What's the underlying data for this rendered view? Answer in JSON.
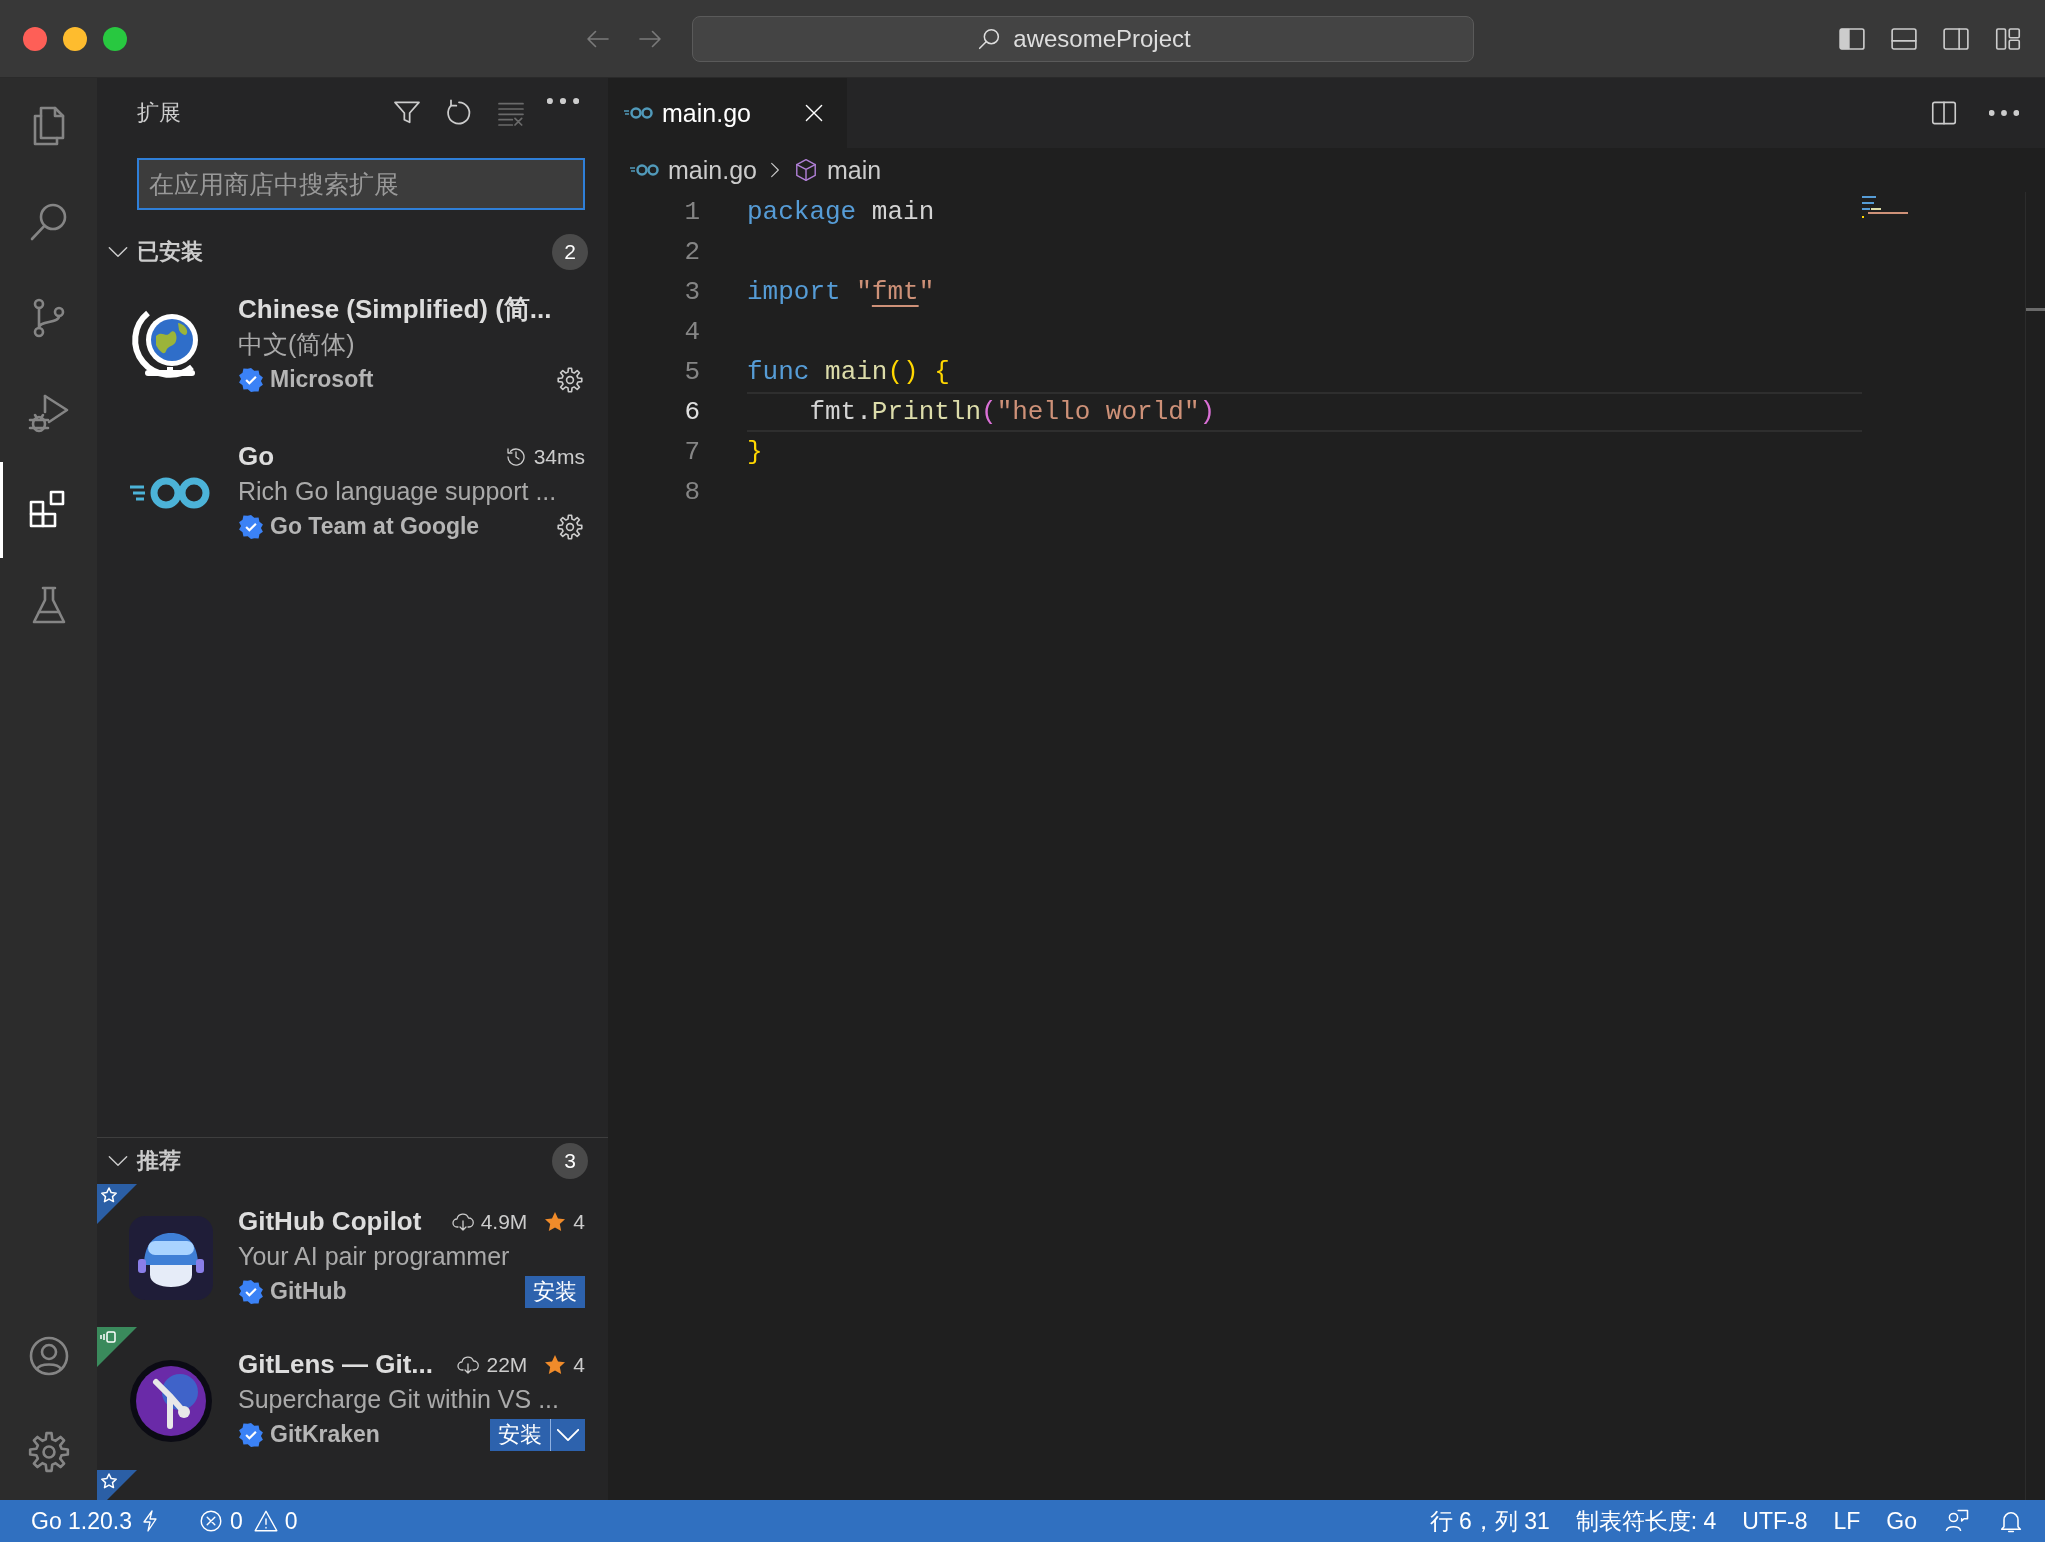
{
  "window": {
    "title": "awesomeProject"
  },
  "layout_toggles": [
    {
      "kind": "primary-sidebar",
      "on": true
    },
    {
      "kind": "panel",
      "on": false
    },
    {
      "kind": "secondary-sidebar",
      "on": false
    },
    {
      "kind": "customize-layout"
    }
  ],
  "activity_bar": {
    "items": [
      {
        "kind": "files",
        "selected": false
      },
      {
        "kind": "search",
        "selected": false
      },
      {
        "kind": "source-control",
        "selected": false
      },
      {
        "kind": "run-debug",
        "selected": false
      },
      {
        "kind": "extensions",
        "selected": true
      },
      {
        "kind": "testing",
        "selected": false
      }
    ],
    "bottom": [
      {
        "kind": "account"
      },
      {
        "kind": "manage"
      }
    ]
  },
  "sidebar": {
    "title": "扩展",
    "actions": [
      {
        "kind": "filter",
        "disabled": false
      },
      {
        "kind": "refresh",
        "disabled": false
      },
      {
        "kind": "clear",
        "disabled": true
      },
      {
        "kind": "more",
        "disabled": false
      }
    ],
    "search": {
      "placeholder": "在应用商店中搜索扩展"
    },
    "sections": [
      {
        "title": "已安装",
        "count": "2",
        "expanded": true,
        "items": [
          {
            "logo": {
              "kind": "globe"
            },
            "name": "Chinese (Simplified) (简...",
            "description": "中文(简体)",
            "publisher": "Microsoft",
            "verified": true,
            "action": {
              "kind": "manage"
            }
          },
          {
            "logo": {
              "kind": "go"
            },
            "name": "Go",
            "time": "34ms",
            "description": "Rich Go language support ...",
            "publisher": "Go Team at Google",
            "verified": true,
            "action": {
              "kind": "manage"
            }
          }
        ]
      },
      {
        "title": "推荐",
        "count": "3",
        "expanded": true,
        "items": [
          {
            "ribbon": {
              "kind": "star"
            },
            "logo": {
              "kind": "copilot"
            },
            "name": "GitHub Copilot",
            "downloads": "4.9M",
            "rating": "4",
            "description": "Your AI pair programmer",
            "publisher": "GitHub",
            "verified": true,
            "action": {
              "kind": "install",
              "label": "安装"
            }
          },
          {
            "ribbon": {
              "kind": "remote"
            },
            "logo": {
              "kind": "gitlens"
            },
            "name": "GitLens — Git...",
            "downloads": "22M",
            "rating": "4",
            "description": "Supercharge Git within VS ...",
            "publisher": "GitKraken",
            "verified": true,
            "action": {
              "kind": "install-split",
              "label": "安装"
            }
          },
          {
            "ribbon": {
              "kind": "star"
            }
          }
        ]
      }
    ]
  },
  "editor": {
    "tabs": [
      {
        "label": "main.go",
        "selected": true
      }
    ],
    "breadcrumb": [
      {
        "kind": "file",
        "label": "main.go"
      },
      {
        "kind": "symbol",
        "label": "main"
      }
    ],
    "lines": [
      {
        "number": "1",
        "current": false,
        "tokens": [
          {
            "kind": "keyword",
            "text": "package"
          },
          {
            "kind": "plain",
            "text": " main"
          }
        ]
      },
      {
        "number": "2",
        "current": false
      },
      {
        "number": "3",
        "current": false,
        "tokens": [
          {
            "kind": "keyword",
            "text": "import"
          },
          {
            "kind": "string",
            "text": " \""
          },
          {
            "kind": "string-link",
            "text": "fmt"
          },
          {
            "kind": "string",
            "text": "\""
          }
        ]
      },
      {
        "number": "4",
        "current": false
      },
      {
        "number": "5",
        "current": false,
        "tokens": [
          {
            "kind": "keyword",
            "text": "func"
          },
          {
            "kind": "function",
            "text": " main"
          },
          {
            "kind": "bracket",
            "text": "() {"
          }
        ]
      },
      {
        "number": "6",
        "current": true,
        "tokens": [
          {
            "kind": "plain",
            "text": "    fmt."
          },
          {
            "kind": "function",
            "text": "Println"
          },
          {
            "kind": "bracket2",
            "text": "("
          },
          {
            "kind": "string",
            "text": "\"hello world\""
          },
          {
            "kind": "bracket2",
            "text": ")"
          }
        ]
      },
      {
        "number": "7",
        "current": false,
        "tokens": [
          {
            "kind": "bracket",
            "text": "}"
          }
        ]
      },
      {
        "number": "8",
        "current": false
      }
    ]
  },
  "status_bar": {
    "left": [
      {
        "kind": "go-version",
        "text": "Go 1.20.3"
      },
      {
        "kind": "errors",
        "text": "0"
      },
      {
        "kind": "warnings",
        "text": "0"
      }
    ],
    "right": [
      {
        "kind": "text",
        "text": "行 6，列 31"
      },
      {
        "kind": "text",
        "text": "制表符长度: 4"
      },
      {
        "kind": "text",
        "text": "UTF-8"
      },
      {
        "kind": "text",
        "text": "LF"
      },
      {
        "kind": "text",
        "text": "Go"
      },
      {
        "kind": "feedback"
      },
      {
        "kind": "notifications"
      }
    ]
  }
}
